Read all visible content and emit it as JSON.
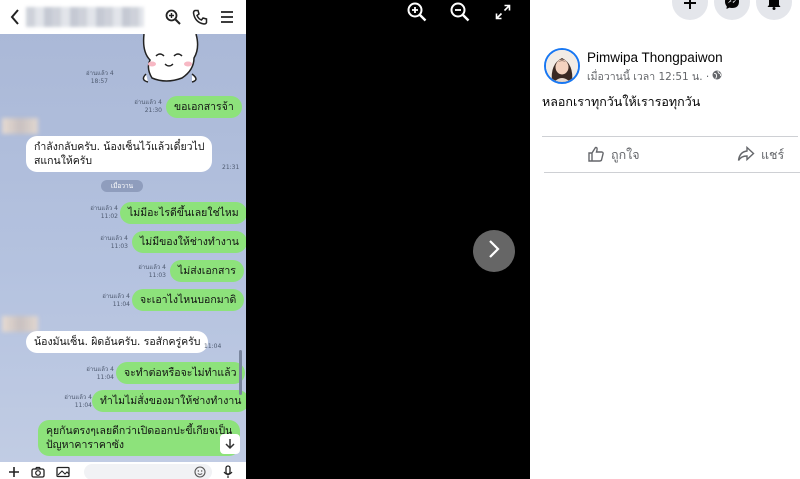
{
  "chat": {
    "messages": [
      {
        "meta": "อ่านแล้ว 4\n18:57"
      },
      {
        "text": "ขอเอกสารจ้า",
        "meta": "อ่านแล้ว 4\n21:30"
      },
      {
        "text": "กำลังกลับครับ. น้องเซ็นไว้แล้วเดี๋ยวไป\nสแกนให้ครับ",
        "meta": "21:31"
      },
      {
        "text": "ไม่มีอะไรดีขึ้นเลยใช่ไหม",
        "meta": "อ่านแล้ว 4\n11:02"
      },
      {
        "text": "ไม่มีของให้ช่างทำงาน",
        "meta": "อ่านแล้ว 4\n11:03"
      },
      {
        "text": "ไม่ส่งเอกสาร",
        "meta": "อ่านแล้ว 4\n11:03"
      },
      {
        "text": "จะเอาไงไหนบอกมาดิ",
        "meta": "อ่านแล้ว 4\n11:04"
      },
      {
        "text": "น้องมันเซ็น. ผิดอันครับ. รอสักครู่ครับ",
        "meta": "11:04"
      },
      {
        "text": "จะทำต่อหรือจะไม่ทำแล้ว",
        "meta": "อ่านแล้ว 4\n11:04"
      },
      {
        "text": "ทำไมไม่สั่งของมาให้ช่างทำงาน",
        "meta": "อ่านแล้ว 4\n11:04"
      },
      {
        "text": "คุยกันตรงๆเลยดีกว่าเปิดออกปะขี้เกียจเป็น\nปัญหาคาราคาซัง",
        "meta": ""
      }
    ],
    "date_divider": "เมื่อวาน"
  },
  "facebook": {
    "author": "Pimwipa Thongpaiwon",
    "post_meta": "เมื่อวานนี้ เวลา 12:51 น. ·",
    "post_text": "หลอกเราทุกวันให้เรารอทุกวัน",
    "like_label": "ถูกใจ",
    "share_label": "แชร์"
  },
  "colors": {
    "chat_bg": "#b4c2df",
    "bubble_out": "#8de27b",
    "bubble_in": "#ffffff",
    "fb_blue": "#1877f2"
  },
  "icons": [
    "back-icon",
    "search-icon",
    "phone-icon",
    "menu-icon",
    "zoom-in-icon",
    "zoom-out-icon",
    "fullscreen-icon",
    "chevron-right-icon",
    "plus-icon",
    "messenger-icon",
    "bell-icon",
    "globe-icon",
    "like-icon",
    "share-icon",
    "camera-icon",
    "image-icon",
    "emoji-icon",
    "mic-icon",
    "arrow-down-icon"
  ]
}
